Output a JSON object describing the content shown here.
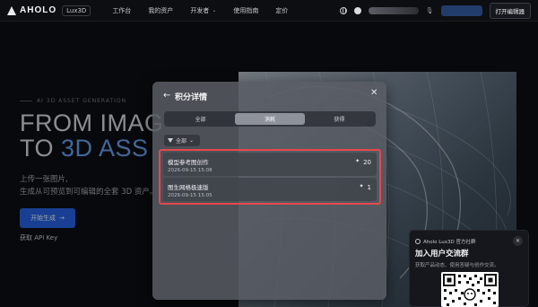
{
  "nav": {
    "logo_text": "AHOLO",
    "logo_badge": "Lux3D",
    "links": [
      {
        "label": "工作台"
      },
      {
        "label": "我的资产"
      },
      {
        "label": "开发者",
        "has_dropdown": true
      },
      {
        "label": "使用指南"
      },
      {
        "label": "定价"
      }
    ],
    "open_editor_label": "打开编辑器"
  },
  "hero": {
    "tag": "AI 3D ASSET GENERATION",
    "line1": "FROM IMAG",
    "line2_plain": "TO ",
    "line2_accent": "3D ASS",
    "desc_line1": "上传一张图片,",
    "desc_line2": "生成从可预览到可编辑的全套 3D 资产。",
    "start_button": "开始生成",
    "start_arrow": "→",
    "api_link": "获取 API Key"
  },
  "modal": {
    "back_icon": "←",
    "title": "积分详情",
    "close_icon": "✕",
    "segments": [
      {
        "label": "全部",
        "active": false
      },
      {
        "label": "消耗",
        "active": true
      },
      {
        "label": "获得",
        "active": false
      }
    ],
    "filter_label": "全部",
    "filter_chevron": "⌄",
    "records": [
      {
        "name": "模型参考图创作",
        "date": "2026-09-15 15:08",
        "points": "20"
      },
      {
        "name": "图生网格极速版",
        "date": "2026-09-15 15:05",
        "points": "1"
      }
    ],
    "highlight_color": "#e5484d"
  },
  "community_card": {
    "brand": "Aholo Lux3D 官方社群",
    "close_icon": "✕",
    "title": "加入用户交流群",
    "subtitle": "获取产品动态、使用答疑与创作交流。"
  },
  "colors": {
    "accent": "#2563eb",
    "hero_accent": "#6aa3f5"
  }
}
